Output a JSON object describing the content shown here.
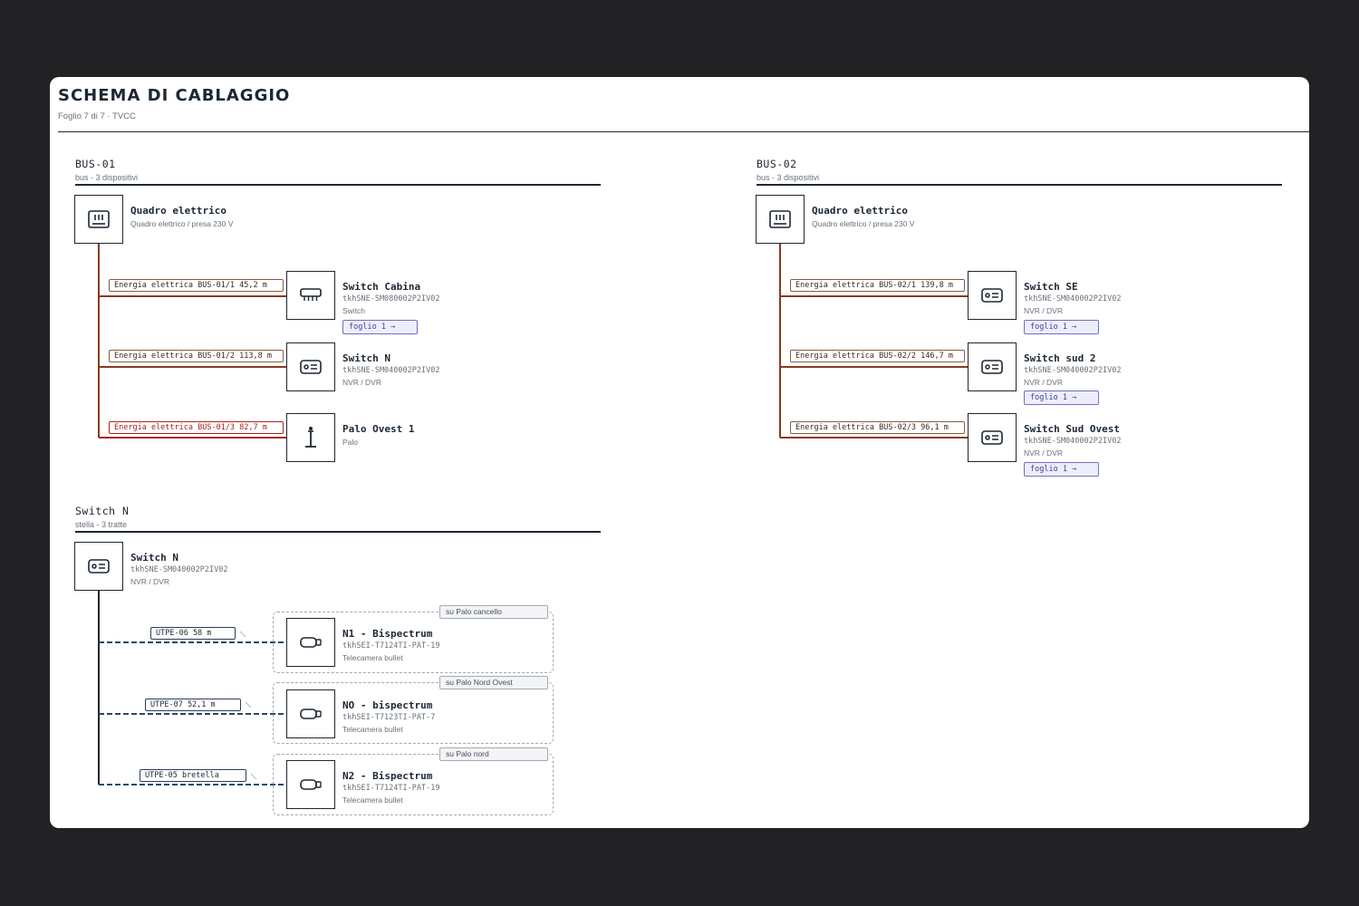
{
  "page": {
    "title": "SCHEMA DI CABLAGGIO",
    "subtitle": "Foglio 7 di 7 · TVCC"
  },
  "colors": {
    "power": "#8b3a1e",
    "power_highlight": "#a82418",
    "data": "#2a4866",
    "link": "#6e70c8"
  },
  "bus01": {
    "title": "BUS-01",
    "subtitle": "bus - 3 dispositivi",
    "source": {
      "name": "Quadro elettrico",
      "type": "Quadro elettrico / presa 230 V",
      "icon": "electrical-panel-icon"
    },
    "devices": [
      {
        "cable": "Energia elettrica BUS-01/1 45,2 m",
        "name": "Switch Cabina",
        "model": "tkhSNE-SM080002P2IV02",
        "type": "Switch",
        "link": "foglio 1 →",
        "icon": "network-switch-icon"
      },
      {
        "cable": "Energia elettrica BUS-01/2 113,8 m",
        "name": "Switch N",
        "model": "tkhSNE-SM040002P2IV02",
        "type": "NVR / DVR",
        "icon": "nvr-icon"
      },
      {
        "cable": "Energia elettrica BUS-01/3 82,7 m",
        "name": "Palo Ovest 1",
        "type": "Palo",
        "icon": "pole-icon"
      }
    ]
  },
  "bus02": {
    "title": "BUS-02",
    "subtitle": "bus - 3 dispositivi",
    "source": {
      "name": "Quadro elettrico",
      "type": "Quadro elettrico / presa 230 V",
      "icon": "electrical-panel-icon"
    },
    "devices": [
      {
        "cable": "Energia elettrica BUS-02/1 139,8 m",
        "name": "Switch SE",
        "model": "tkhSNE-SM040002P2IV02",
        "type": "NVR / DVR",
        "link": "foglio 1 →",
        "icon": "nvr-icon"
      },
      {
        "cable": "Energia elettrica BUS-02/2 146,7 m",
        "name": "Switch sud 2",
        "model": "tkhSNE-SM040002P2IV02",
        "type": "NVR / DVR",
        "link": "foglio 1 →",
        "icon": "nvr-icon"
      },
      {
        "cable": "Energia elettrica BUS-02/3 96,1 m",
        "name": "Switch Sud Ovest",
        "model": "tkhSNE-SM040002P2IV02",
        "type": "NVR / DVR",
        "link": "foglio 1 →",
        "icon": "nvr-icon"
      }
    ]
  },
  "star": {
    "title": "Switch N",
    "subtitle": "stella - 3 tratte",
    "source": {
      "name": "Switch N",
      "model": "tkhSNE-SM040002P2IV02",
      "type": "NVR / DVR",
      "icon": "nvr-icon"
    },
    "devices": [
      {
        "cable": "UTPE-06 58 m",
        "group": "su Palo cancello",
        "name": "N1 - Bispectrum",
        "model": "tkhSEI-T7124TI-PAT-19",
        "type": "Telecamera bullet",
        "icon": "bullet-camera-icon"
      },
      {
        "cable": "UTPE-07 52,1 m",
        "group": "su Palo Nord Ovest",
        "name": "NO - bispectrum",
        "model": "tkhSEI-T7123TI-PAT-7",
        "type": "Telecamera bullet",
        "icon": "bullet-camera-icon"
      },
      {
        "cable": "UTPE-05 bretella",
        "group": "su Palo nord",
        "name": "N2 - Bispectrum",
        "model": "tkhSEI-T7124TI-PAT-19",
        "type": "Telecamera bullet",
        "icon": "bullet-camera-icon"
      }
    ]
  }
}
